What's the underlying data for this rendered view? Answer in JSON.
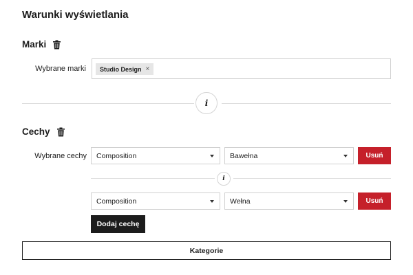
{
  "page": {
    "title": "Warunki wyświetlania"
  },
  "brands": {
    "heading": "Marki",
    "trash_icon": "trash-icon",
    "field_label": "Wybrane marki",
    "chips": [
      {
        "label": "Studio Design",
        "remove_glyph": "×"
      }
    ]
  },
  "info_icon": {
    "glyph": "i",
    "name": "info-icon"
  },
  "features": {
    "heading": "Cechy",
    "trash_icon": "trash-icon",
    "field_label": "Wybrane cechy",
    "rows": [
      {
        "attribute": "Composition",
        "value": "Bawełna",
        "remove_label": "Usuń"
      },
      {
        "attribute": "Composition",
        "value": "Wełna",
        "remove_label": "Usuń"
      }
    ],
    "add_label": "Dodaj cechę"
  },
  "categories_button": {
    "label": "Kategorie"
  },
  "colors": {
    "text": "#1c1c1c",
    "danger": "#c5202a",
    "border": "#cfcfcf",
    "chip": "#e6e6e6"
  }
}
